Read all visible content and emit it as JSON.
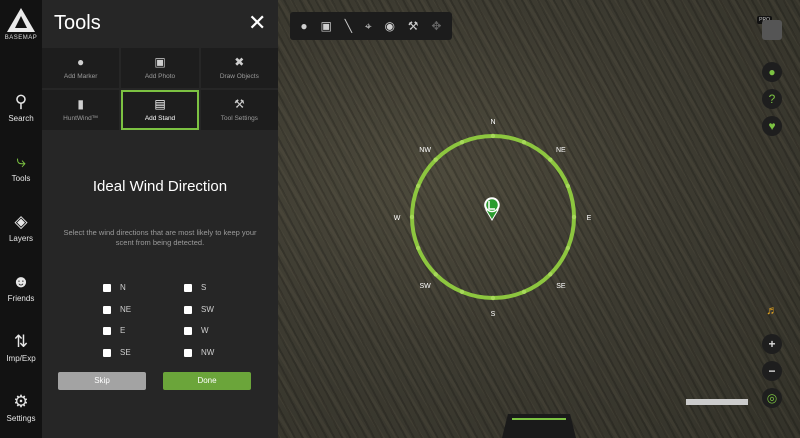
{
  "app": {
    "logo_text": "BASEMAP"
  },
  "left_nav": [
    {
      "label": "Search",
      "icon": "search-icon"
    },
    {
      "label": "Tools",
      "icon": "tools-icon",
      "active": true
    },
    {
      "label": "Layers",
      "icon": "layers-icon"
    },
    {
      "label": "Friends",
      "icon": "friends-icon"
    },
    {
      "label": "Imp/Exp",
      "icon": "import-export-icon"
    },
    {
      "label": "Settings",
      "icon": "gear-icon"
    }
  ],
  "panel": {
    "title": "Tools",
    "close_icon": "close-icon",
    "tools": [
      {
        "label": "Add Marker",
        "icon": "map-pin-icon"
      },
      {
        "label": "Add Photo",
        "icon": "camera-icon"
      },
      {
        "label": "Draw Objects",
        "icon": "draw-objects-icon"
      },
      {
        "label": "HuntWind™",
        "icon": "huntwind-icon"
      },
      {
        "label": "Add Stand",
        "icon": "stand-icon",
        "selected": true
      },
      {
        "label": "Tool Settings",
        "icon": "wrench-icon"
      }
    ],
    "wind": {
      "title": "Ideal Wind Direction",
      "description": "Select the wind directions that are most likely to keep your scent from being detected.",
      "directions_left": [
        "N",
        "NE",
        "E",
        "SE"
      ],
      "directions_right": [
        "S",
        "SW",
        "W",
        "NW"
      ]
    },
    "skip_label": "Skip",
    "done_label": "Done"
  },
  "map": {
    "toolbar_icons": [
      "map-pin-icon",
      "camera-icon",
      "line-icon",
      "crop-icon",
      "target-icon",
      "wrench-icon",
      "move-icon"
    ],
    "pro_badge": "PRO",
    "compass_labels": [
      "N",
      "NE",
      "E",
      "SE",
      "S",
      "SW",
      "W",
      "NW"
    ],
    "accent_color": "#7cc242"
  }
}
